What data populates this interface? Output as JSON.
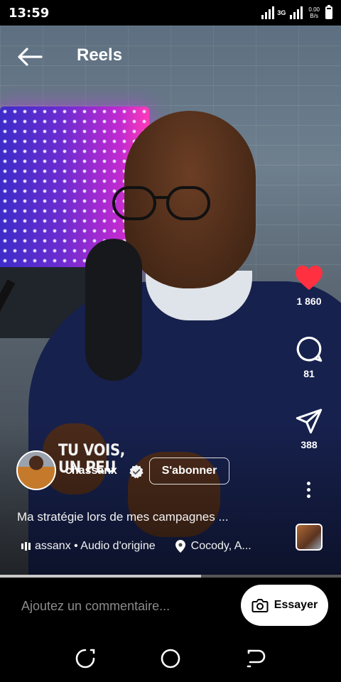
{
  "status_bar": {
    "time": "13:59",
    "network_type": "3G",
    "net_speed": "0.00",
    "net_speed_unit": "B/s"
  },
  "header": {
    "title": "Reels",
    "back_icon": "arrow-left-icon"
  },
  "video": {
    "overlay_text_line1": "TU VOIS,",
    "overlay_text_line2": "UN PEU",
    "progress_fraction": 0.59
  },
  "actions": {
    "like": {
      "icon": "heart-icon",
      "count": "1 860",
      "color": "#ff3040",
      "liked": true
    },
    "comment": {
      "icon": "comment-bubble-icon",
      "count": "81"
    },
    "share": {
      "icon": "paper-plane-icon",
      "count": "388"
    },
    "more": {
      "icon": "more-vertical-icon"
    }
  },
  "author": {
    "username": "chassanx",
    "verified": true,
    "follow_label": "S'abonner"
  },
  "post": {
    "caption": "Ma stratégie lors de mes campagnes ...",
    "audio": "assanx • Audio d'origine",
    "location": "Cocody, A..."
  },
  "comment_bar": {
    "placeholder": "Ajoutez un commentaire...",
    "try_label": "Essayer"
  }
}
